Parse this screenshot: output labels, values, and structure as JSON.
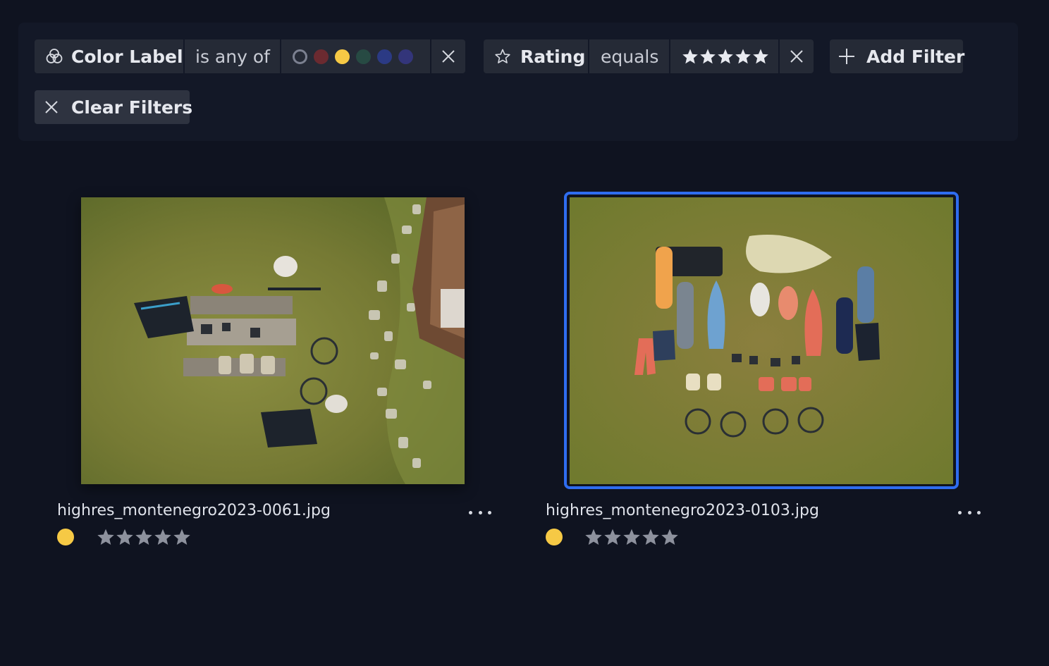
{
  "filters": {
    "color_filter": {
      "field": "Color Label",
      "operator": "is any of",
      "dots": [
        {
          "name": "none",
          "color": "#7b8090",
          "hollow": true
        },
        {
          "name": "red",
          "color": "#6b2a30"
        },
        {
          "name": "yellow",
          "color": "#f6c945"
        },
        {
          "name": "green",
          "color": "#274a43"
        },
        {
          "name": "blue",
          "color": "#2b3a84"
        },
        {
          "name": "purple",
          "color": "#33357a"
        }
      ]
    },
    "rating_filter": {
      "field": "Rating",
      "operator": "equals",
      "stars": 5
    },
    "add_filter_label": "Add Filter",
    "clear_filters_label": "Clear Filters"
  },
  "thumbnails": [
    {
      "filename": "highres_montenegro2023-0061.jpg",
      "color_label": "#f6c945",
      "rating": 5,
      "selected": false
    },
    {
      "filename": "highres_montenegro2023-0103.jpg",
      "color_label": "#f6c945",
      "rating": 5,
      "selected": true
    }
  ],
  "colors": {
    "background": "#0f1320",
    "panel": "#131827",
    "chip": "#252a36",
    "selection": "#2f6df0",
    "star_gray": "#8d919d",
    "star_white": "#e8eaf0"
  }
}
